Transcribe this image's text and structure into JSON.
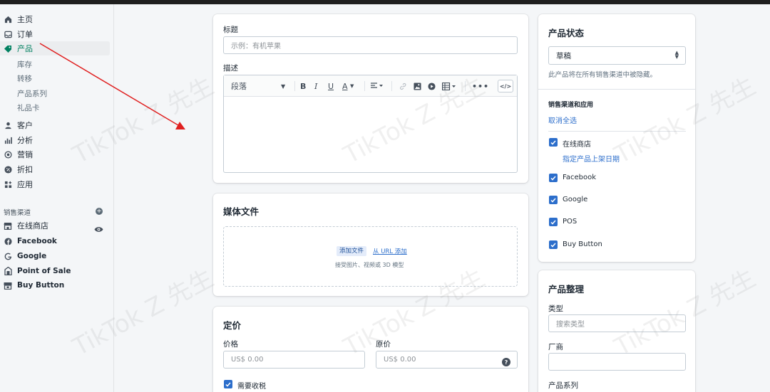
{
  "sidebar": {
    "items": [
      {
        "label": "主页",
        "icon": "home-icon"
      },
      {
        "label": "订单",
        "icon": "inbox-icon"
      },
      {
        "label": "产品",
        "icon": "tag-icon",
        "active": true
      },
      {
        "label": "客户",
        "icon": "person-icon"
      },
      {
        "label": "分析",
        "icon": "bar-chart-icon"
      },
      {
        "label": "营销",
        "icon": "target-icon"
      },
      {
        "label": "折扣",
        "icon": "discount-icon"
      },
      {
        "label": "应用",
        "icon": "apps-icon"
      }
    ],
    "product_subitems": [
      "库存",
      "转移",
      "产品系列",
      "礼品卡"
    ],
    "channels_label": "销售渠道",
    "channels": [
      {
        "label": "在线商店",
        "icon": "store-icon"
      },
      {
        "label": "Facebook",
        "icon": "facebook-icon"
      },
      {
        "label": "Google",
        "icon": "google-icon"
      },
      {
        "label": "Point of Sale",
        "icon": "pos-icon"
      },
      {
        "label": "Buy Button",
        "icon": "buy-button-icon"
      }
    ]
  },
  "main": {
    "title_label": "标题",
    "title_placeholder": "示例：有机苹果",
    "description_label": "描述",
    "toolbar": {
      "paragraph": "段落"
    },
    "media": {
      "title": "媒体文件",
      "add_file": "添加文件",
      "add_from_url": "从 URL 添加",
      "hint": "接受图片、视频或 3D 模型"
    },
    "pricing": {
      "title": "定价",
      "price_label": "价格",
      "price_value": "US$  0.00",
      "compare_label": "原价",
      "compare_value": "US$  0.00",
      "tax_label": "需要收税"
    }
  },
  "status_card": {
    "title": "产品状态",
    "status_value": "草稿",
    "status_hint": "此产品将在所有销售渠道中被隐藏。",
    "channels_title": "销售渠道和应用",
    "deselect_all": "取消全选",
    "channels": [
      {
        "label": "在线商店",
        "checked": true
      },
      {
        "label": "Facebook",
        "checked": true
      },
      {
        "label": "Google",
        "checked": true
      },
      {
        "label": "POS",
        "checked": true
      },
      {
        "label": "Buy Button",
        "checked": true
      }
    ],
    "schedule_link": "指定产品上架日期"
  },
  "organization_card": {
    "title": "产品整理",
    "type_label": "类型",
    "type_placeholder": "搜索类型",
    "vendor_label": "厂商",
    "collections_label": "产品系列"
  },
  "watermark": "TikTok Z 先生",
  "colors": {
    "accent": "#008060",
    "link": "#2c6ecb",
    "arrow": "#e02020"
  }
}
